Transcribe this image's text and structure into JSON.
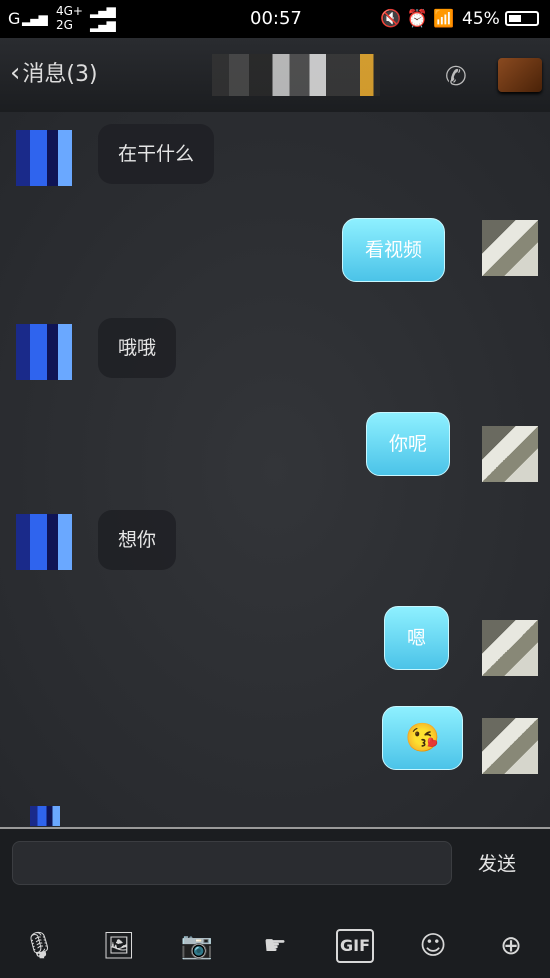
{
  "status_bar": {
    "carrier": "G",
    "network_top": "4G+",
    "network_bottom": "2G",
    "time": "00:57",
    "battery": "45%"
  },
  "header": {
    "back_label": "消息(3)"
  },
  "messages": [
    {
      "side": "left",
      "text": "在干什么"
    },
    {
      "side": "right",
      "text": "看视频"
    },
    {
      "side": "left",
      "text": "哦哦"
    },
    {
      "side": "right",
      "text": "你呢"
    },
    {
      "side": "left",
      "text": "想你"
    },
    {
      "side": "right",
      "text": "嗯"
    },
    {
      "side": "right",
      "text": "😘"
    }
  ],
  "input": {
    "value": "",
    "send_label": "发送"
  },
  "toolbar": {
    "gif_label": "GIF",
    "icons": [
      "microphone-icon",
      "image-icon",
      "camera-icon",
      "poke-icon",
      "gif-icon",
      "emoji-icon",
      "plus-icon"
    ]
  }
}
